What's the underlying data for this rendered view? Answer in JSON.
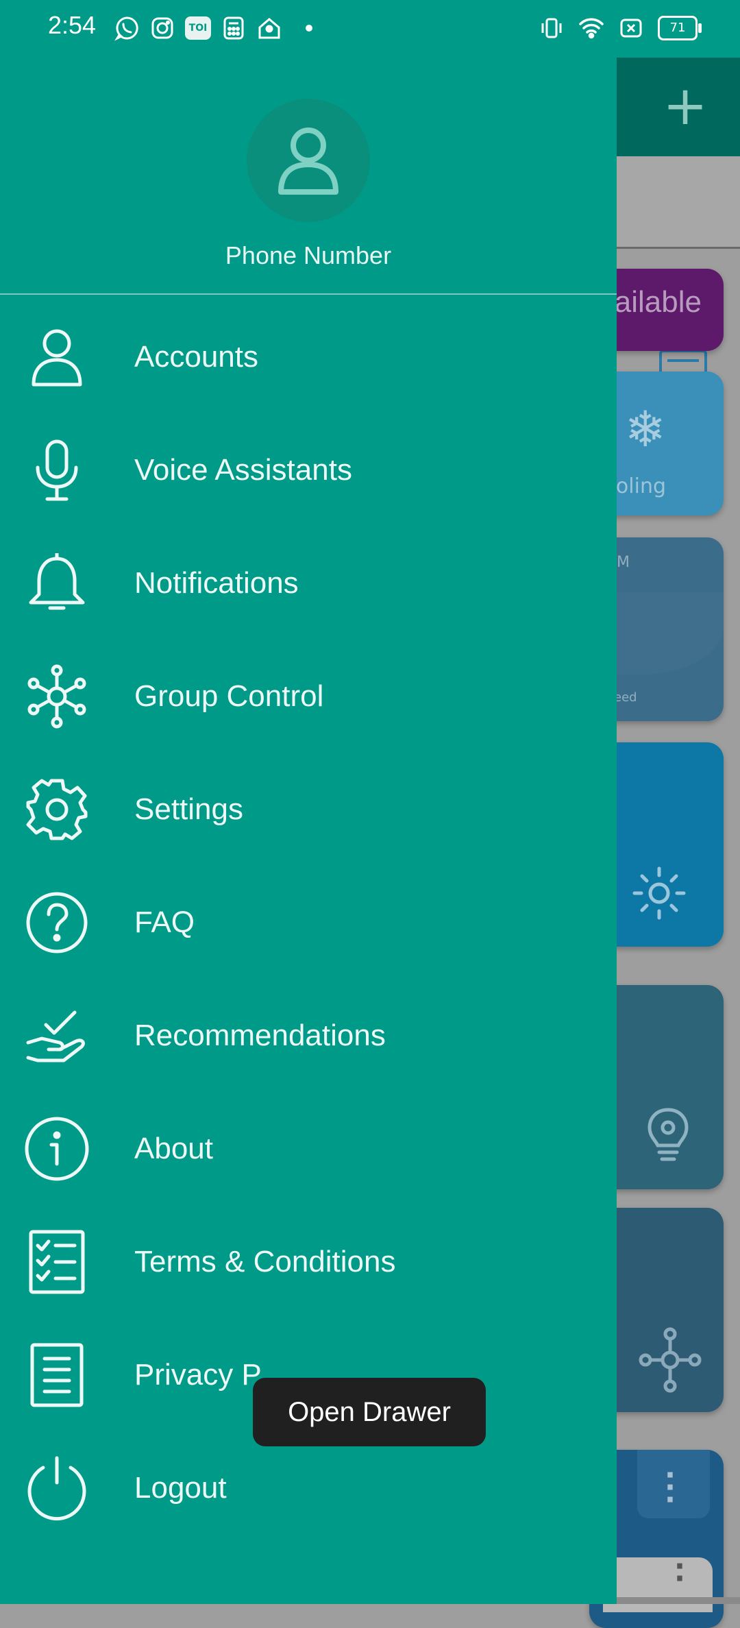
{
  "status_bar": {
    "time": "2:54",
    "battery": "71",
    "left_icons": [
      "whatsapp-icon",
      "instagram-icon",
      "toi-icon",
      "calculator-icon",
      "home-location-icon",
      "notification-dot"
    ],
    "toi_label": "TOI",
    "right_icons": [
      "vibrate-icon",
      "wifi-icon",
      "no-sim-icon",
      "battery-icon"
    ]
  },
  "background": {
    "add_symbol": "+",
    "card_available_text": "ailable",
    "card_cooling_text": "ooling",
    "card_mode_text": "M",
    "card_speed_text": "eed"
  },
  "drawer": {
    "phone_label": "Phone Number",
    "menu": [
      {
        "label": "Accounts",
        "icon": "person-icon"
      },
      {
        "label": "Voice Assistants",
        "icon": "microphone-icon"
      },
      {
        "label": "Notifications",
        "icon": "bell-icon"
      },
      {
        "label": "Group Control",
        "icon": "group-control-icon"
      },
      {
        "label": "Settings",
        "icon": "gear-icon"
      },
      {
        "label": "FAQ",
        "icon": "question-icon"
      },
      {
        "label": "Recommendations",
        "icon": "hand-check-icon"
      },
      {
        "label": "About",
        "icon": "info-icon"
      },
      {
        "label": "Terms & Conditions",
        "icon": "checklist-icon"
      },
      {
        "label": "Privacy P",
        "icon": "document-icon"
      },
      {
        "label": "Logout",
        "icon": "power-icon"
      }
    ]
  },
  "tooltip": {
    "text": "Open Drawer"
  },
  "colors": {
    "drawer": "#009b88",
    "status_bar": "#009b88",
    "tooltip": "#202020",
    "text": "#eef8f6"
  }
}
